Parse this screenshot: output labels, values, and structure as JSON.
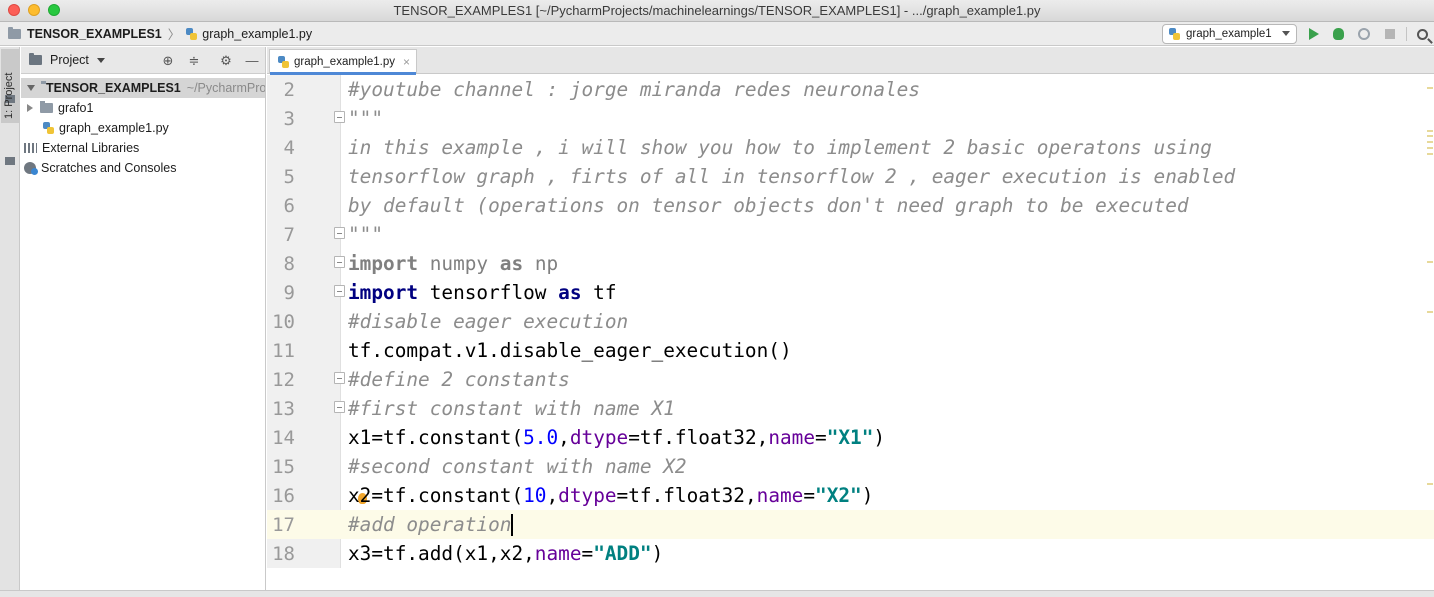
{
  "window": {
    "title": "TENSOR_EXAMPLES1 [~/PycharmProjects/machinelearnings/TENSOR_EXAMPLES1] - .../graph_example1.py"
  },
  "navbar": {
    "project_crumb": "TENSOR_EXAMPLES1",
    "file_crumb": "graph_example1.py",
    "run_config": "graph_example1"
  },
  "sidebar_strip": {
    "label": "1: Project"
  },
  "project_panel": {
    "header": "Project",
    "root_name": "TENSOR_EXAMPLES1",
    "root_path": "~/PycharmProjects/",
    "items": [
      {
        "label": "grafo1"
      },
      {
        "label": "graph_example1.py"
      },
      {
        "label": "External Libraries"
      },
      {
        "label": "Scratches and Consoles"
      }
    ]
  },
  "editor": {
    "tab_label": "graph_example1.py",
    "lines": [
      {
        "num": "2"
      },
      {
        "num": "3"
      },
      {
        "num": "4"
      },
      {
        "num": "5"
      },
      {
        "num": "6"
      },
      {
        "num": "7"
      },
      {
        "num": "8"
      },
      {
        "num": "9"
      },
      {
        "num": "10"
      },
      {
        "num": "11"
      },
      {
        "num": "12"
      },
      {
        "num": "13"
      },
      {
        "num": "14"
      },
      {
        "num": "15"
      },
      {
        "num": "16"
      },
      {
        "num": "17"
      },
      {
        "num": "18"
      }
    ],
    "code": {
      "l2": "#youtube channel : jorge miranda redes neuronales",
      "l3": "\"\"\"",
      "l4": "in this example , i will show you how to implement 2 basic operatons using",
      "l5": "tensorflow graph , firts of all in tensorflow 2 , eager execution is enabled",
      "l6": "by default (operations on tensor objects don't need graph to be executed",
      "l7": "\"\"\"",
      "l8_kw1": "import",
      "l8_mod": " numpy ",
      "l8_kw2": "as",
      "l8_alias": " np",
      "l9_kw1": "import",
      "l9_mod": " tensorflow ",
      "l9_kw2": "as",
      "l9_alias": " tf",
      "l10": "#disable eager execution",
      "l11": "tf.compat.v1.disable_eager_execution()",
      "l12": "#define 2 constants",
      "l13": "#first constant with name X1",
      "l14_a": "x1=tf.constant(",
      "l14_num": "5.0",
      "l14_b": ",",
      "l14_p1": "dtype",
      "l14_c": "=tf.float32,",
      "l14_p2": "name",
      "l14_d": "=",
      "l14_str": "\"X1\"",
      "l14_e": ")",
      "l15": "#second constant with name X2",
      "l16_a": "x2=tf.constant(",
      "l16_num": "10",
      "l16_b": ",",
      "l16_p1": "dtype",
      "l16_c": "=tf.float32,",
      "l16_p2": "name",
      "l16_d": "=",
      "l16_str": "\"X2\"",
      "l16_e": ")",
      "l17": "#add operation",
      "l18_a": "x3=tf.add(x1,x2,",
      "l18_p": "name",
      "l18_d": "=",
      "l18_str": "\"ADD\"",
      "l18_e": ")"
    }
  },
  "colors": {
    "comment": "#8c8c8c",
    "keyword": "#000080",
    "number": "#0000ff",
    "param": "#660099",
    "string": "#008080",
    "current_line": "#fdfbe8"
  }
}
